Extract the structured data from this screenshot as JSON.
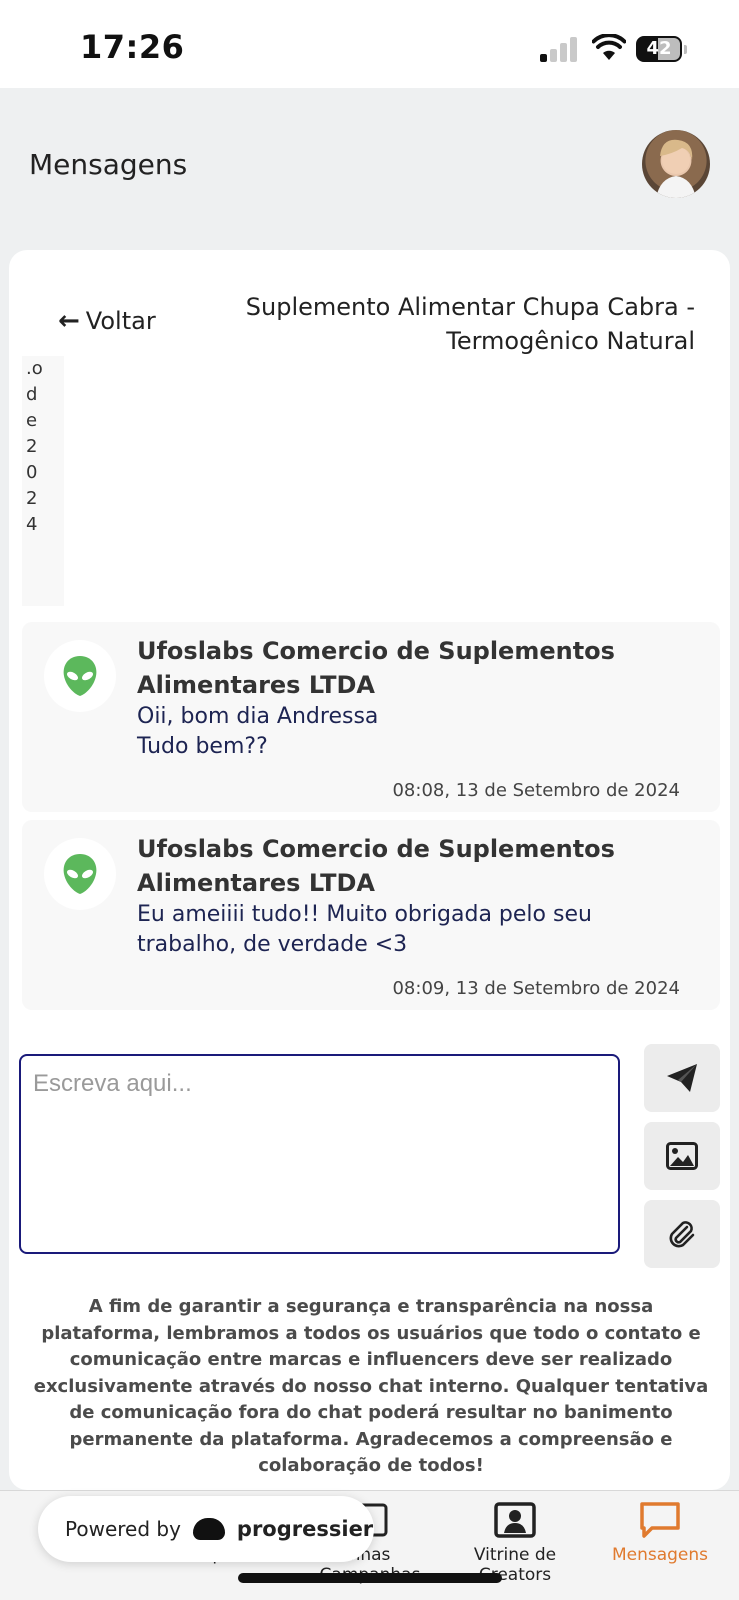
{
  "status_bar": {
    "time": "17:26",
    "battery": "42"
  },
  "header": {
    "title": "Mensagens"
  },
  "chat": {
    "back_label": "Voltar",
    "product_title": "Suplemento Alimentar Chupa Cabra - Termogênico Natural",
    "partial_date_text": ".o de 2024",
    "messages": [
      {
        "sender": "Ufoslabs Comercio de Suplementos Alimentares LTDA",
        "text": "Oii, bom dia Andressa\nTudo bem??",
        "time": "08:08, 13 de Setembro de 2024"
      },
      {
        "sender": "Ufoslabs Comercio de Suplementos Alimentares LTDA",
        "text": "Eu ameiiii tudo!! Muito obrigada pelo seu trabalho, de verdade <3",
        "time": "08:09, 13 de Setembro de 2024"
      }
    ],
    "input": {
      "placeholder": "Escreva aqui..."
    },
    "notice": "A fim de garantir a segurança e transparência na nossa plataforma, lembramos a todos os usuários que todo o contato e comunicação entre marcas e influencers deve ser realizado exclusivamente através do nosso chat interno. Qualquer tentativa de comunicação fora do chat poderá resultar no banimento permanente da plataforma. Agradecemos a compreensão e colaboração de todos!"
  },
  "bottom_nav": {
    "items": [
      {
        "label": "Campanhas"
      },
      {
        "label": "nhas Campanhas"
      },
      {
        "label": "Vitrine de Creators"
      },
      {
        "label": "Mensagens"
      }
    ],
    "active_color": "#e07a2e"
  },
  "powered_by": {
    "prefix": "Powered by",
    "brand": "progressier"
  }
}
